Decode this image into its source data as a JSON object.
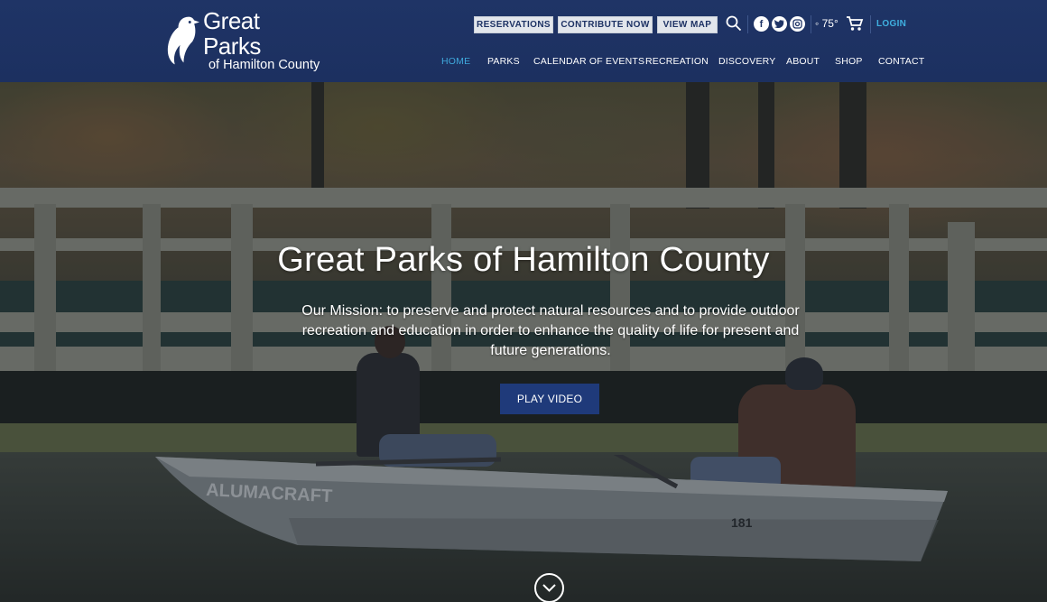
{
  "brand": {
    "name_line1": "Great Parks",
    "name_line2": "of Hamilton County"
  },
  "utility": {
    "reservations": "RESERVATIONS",
    "contribute": "CONTRIBUTE NOW",
    "view_map": "VIEW MAP",
    "search_icon": "search-icon",
    "social": [
      "f",
      "t",
      "ig"
    ],
    "weather": "75°",
    "login": "LOGIN"
  },
  "nav": {
    "items": [
      "HOME",
      "PARKS",
      "CALENDAR OF EVENTS",
      "RECREATION",
      "DISCOVERY",
      "ABOUT",
      "SHOP",
      "CONTACT"
    ],
    "active": "HOME",
    "active_color": "#3fa8db"
  },
  "hero": {
    "title": "Great Parks of Hamilton County",
    "mission": "Our Mission: to preserve and protect natural resources and to provide outdoor recreation and education in order to enhance the quality of life for present and future generations.",
    "play_label": "PLAY VIDEO",
    "boat_brand": "ALUMACRAFT",
    "boat_number": "181"
  },
  "colors": {
    "header_bg": "#1f3466",
    "accent": "#3fb0e0",
    "button_bg": "#1f3a7a"
  }
}
